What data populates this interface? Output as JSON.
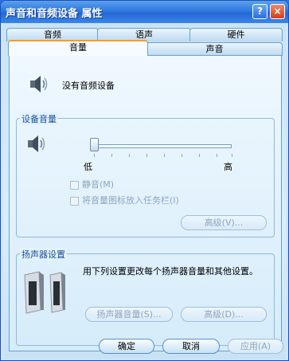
{
  "window": {
    "title": "声音和音频设备 属性"
  },
  "titlebar": {
    "help_glyph": "?",
    "close_glyph": "×"
  },
  "tabs": {
    "row1": [
      "音频",
      "语声",
      "硬件"
    ],
    "row2": [
      "音量",
      "声音"
    ],
    "active": "音量"
  },
  "device": {
    "text": "没有音频设备",
    "icon": "speaker-icon"
  },
  "volume_group": {
    "label": "设备音量",
    "slider_low": "低",
    "slider_high": "高",
    "slider_value": 0,
    "mute_label": "静音(M)",
    "tray_icon_label": "将音量图标放入任务栏(I)",
    "advanced_button": "高级(V)..."
  },
  "speaker_group": {
    "label": "扬声器设置",
    "description": "用下列设置更改每个扬声器音量和其他设置。",
    "speaker_volume_button": "扬声器音量(S)...",
    "advanced_button": "高级(D)..."
  },
  "footer": {
    "ok": "确定",
    "cancel": "取消",
    "apply": "应用(A)"
  }
}
